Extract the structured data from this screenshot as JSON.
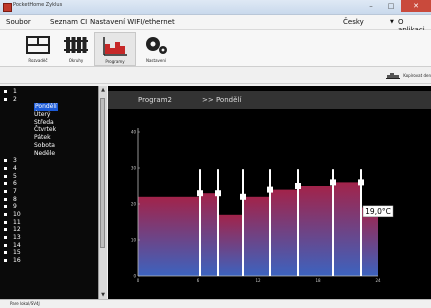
{
  "window": {
    "title": "PocketHome Zyklus",
    "buttons": [
      "–",
      "□",
      "✕"
    ]
  },
  "menu": {
    "items": [
      "Soubor",
      "Seznam CI",
      "Nastavení WIFI/ethernet"
    ],
    "language": "Česky",
    "about": "O aplikaci"
  },
  "toolbar": {
    "items": [
      {
        "label": "Rozvaděč",
        "icon": "switchboard-icon"
      },
      {
        "label": "Okruhy",
        "icon": "radiator-icon"
      },
      {
        "label": "Programy",
        "icon": "program-chart-icon"
      },
      {
        "label": "Nastavení",
        "icon": "gears-icon"
      }
    ],
    "active": "Programy"
  },
  "subtoolbar": {
    "copy_label": "Kopírovat den"
  },
  "tree": [
    {
      "label": "1",
      "type": "node"
    },
    {
      "label": "2",
      "type": "node"
    },
    {
      "label": "Pondělí",
      "type": "child",
      "selected": true
    },
    {
      "label": "Úterý",
      "type": "child"
    },
    {
      "label": "Středa",
      "type": "child"
    },
    {
      "label": "Čtvrtek",
      "type": "child"
    },
    {
      "label": "Pátek",
      "type": "child"
    },
    {
      "label": "Sobota",
      "type": "child"
    },
    {
      "label": "Neděle",
      "type": "child"
    },
    {
      "label": "3",
      "type": "node"
    },
    {
      "label": "4",
      "type": "node"
    },
    {
      "label": "5",
      "type": "node"
    },
    {
      "label": "6",
      "type": "node"
    },
    {
      "label": "7",
      "type": "node"
    },
    {
      "label": "8",
      "type": "node"
    },
    {
      "label": "9",
      "type": "node"
    },
    {
      "label": "10",
      "type": "node"
    },
    {
      "label": "11",
      "type": "node"
    },
    {
      "label": "12",
      "type": "node"
    },
    {
      "label": "13",
      "type": "node"
    },
    {
      "label": "14",
      "type": "node"
    },
    {
      "label": "15",
      "type": "node"
    },
    {
      "label": "16",
      "type": "node"
    }
  ],
  "header": {
    "program": "Program2",
    "day": ">> Pondělí"
  },
  "chart_data": {
    "type": "area",
    "xlim": [
      0,
      24
    ],
    "ylim": [
      0,
      40
    ],
    "xticks": [
      "0",
      "6",
      "12",
      "18",
      "24"
    ],
    "yticks": [
      "0",
      "10",
      "20",
      "30",
      "40"
    ],
    "steps": [
      {
        "start": 0,
        "end": 6.2,
        "value": 22
      },
      {
        "start": 6.2,
        "end": 8,
        "value": 23
      },
      {
        "start": 8,
        "end": 10.5,
        "value": 17
      },
      {
        "start": 10.5,
        "end": 13.2,
        "value": 22
      },
      {
        "start": 13.2,
        "end": 16,
        "value": 24
      },
      {
        "start": 16,
        "end": 19.5,
        "value": 25
      },
      {
        "start": 19.5,
        "end": 22.3,
        "value": 26
      },
      {
        "start": 22.3,
        "end": 24,
        "value": 19
      }
    ],
    "handles": [
      6.2,
      8,
      10.5,
      13.2,
      16,
      19.5,
      22.3
    ],
    "tooltip": "19,0°C",
    "gradient_top": "#a2234a",
    "gradient_bottom": "#3c63bf"
  },
  "status": {
    "text": "Pare lokal/SV4J"
  }
}
